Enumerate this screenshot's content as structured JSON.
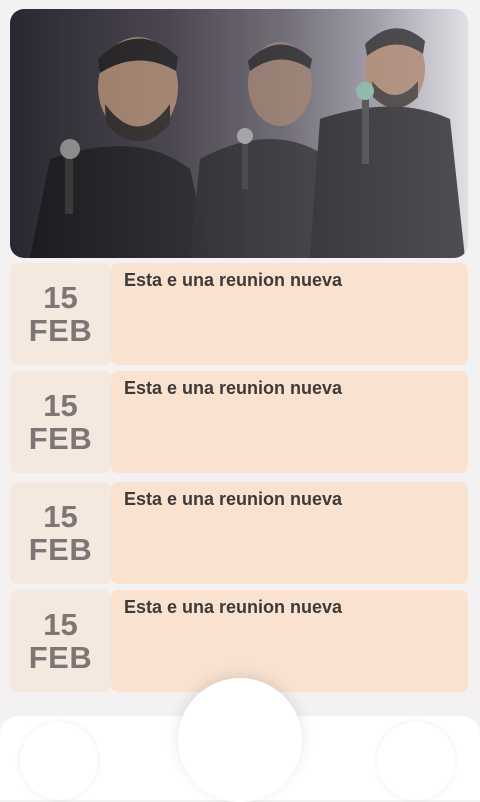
{
  "hero": {
    "image": "preacher-with-microphone-collage"
  },
  "events": [
    {
      "day": "15",
      "month": "FEB",
      "title": "Esta e una reunion nueva"
    },
    {
      "day": "15",
      "month": "FEB",
      "title": "Esta e una reunion nueva"
    },
    {
      "day": "15",
      "month": "FEB",
      "title": "Esta e una reunion nueva"
    },
    {
      "day": "15",
      "month": "FEB",
      "title": "Esta e una reunion nueva"
    }
  ],
  "colors": {
    "date_bg": "#f5e8df",
    "card_bg": "#f9e3d0",
    "date_text": "#7c7675",
    "title_text": "#3f3a38"
  },
  "bottom_nav": {
    "left_icon": "nav-left-icon",
    "center_icon": "nav-center-icon",
    "right_icon": "nav-right-icon"
  }
}
